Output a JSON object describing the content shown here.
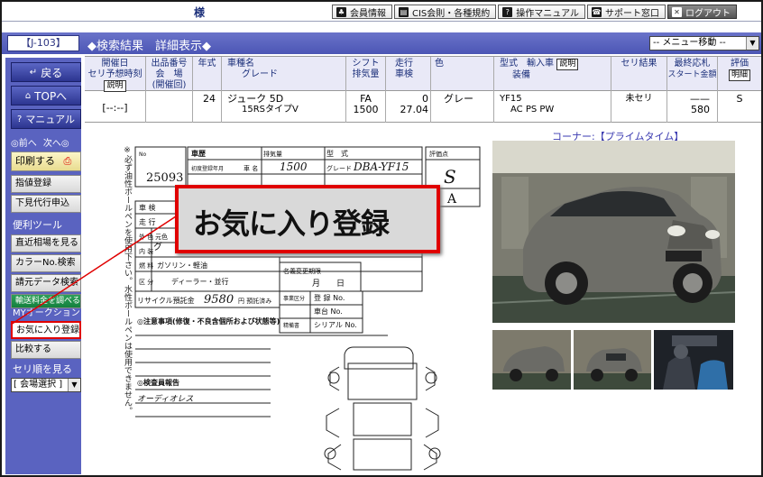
{
  "header": {
    "user_suffix": "様",
    "links": [
      {
        "icon": "club-icon",
        "glyph": "♣",
        "label": "会員情報"
      },
      {
        "icon": "cis-icon",
        "glyph": "▤",
        "label": "CIS会則・各種規約"
      },
      {
        "icon": "help-icon",
        "glyph": "?",
        "label": "操作マニュアル"
      },
      {
        "icon": "phone-icon",
        "glyph": "☎",
        "label": "サポート窓口"
      },
      {
        "icon": "close-icon",
        "glyph": "✕",
        "label": "ログアウト"
      }
    ]
  },
  "titlebar": {
    "id": "【J-103】",
    "title": "◆検索結果　詳細表示◆",
    "menu": "-- メニュー移動 --"
  },
  "sidebar": {
    "back": "戻る",
    "top": "TOPへ",
    "manual": "マニュアル",
    "prev": "◎前へ",
    "next": "次へ◎",
    "print": "印刷する",
    "bid": "指値登録",
    "order": "下見代行申込",
    "tools_heading": "便利ツール",
    "market": "直近相場を見る",
    "color_search": "カラーNo.検索",
    "past_data": "請元データ検索",
    "fee": "輸送料金を調べる",
    "my_auction": "MYオークション",
    "favorite": "お気に入り登録",
    "compare": "比較する",
    "order_heading": "セリ順を見る",
    "venue_select": "[ 会場選択 ]"
  },
  "table": {
    "headers": {
      "date": [
        "開催日",
        "セリ予想時刻"
      ],
      "date_btn": "説明",
      "lot": [
        "出品番号",
        "会　場",
        "(開催回)"
      ],
      "year": "年式",
      "model": [
        "車種名",
        "グレード"
      ],
      "shift": [
        "シフト",
        "排気量"
      ],
      "mileage": [
        "走行",
        "車検"
      ],
      "color": "色",
      "type": [
        "型式　輸入車",
        "装備"
      ],
      "type_btn": "説明",
      "result": "セリ結果",
      "price": [
        "最終応札",
        "スタート金額"
      ],
      "grade": "評価",
      "grade_btn": "明細"
    },
    "row": {
      "date": "[--:--]",
      "lot": "",
      "year": "24",
      "model": "ジューク 5D",
      "grade_name": "15RSタイプV",
      "shift": "FA",
      "cc": "1500",
      "mileage": "0",
      "inspection": "27.04",
      "color": "グレー",
      "type": "YF15",
      "equipment": "AC PS PW",
      "result": "未セリ",
      "final_bid": "——",
      "start_price": "580",
      "score": "S"
    }
  },
  "corner_label": "コーナー:【プライムタイム】",
  "sheet": {
    "lot_no": "25093",
    "mileage_hand": "1500",
    "type_hand": "DBA-YF15",
    "grade_hand": "S",
    "score_a": "A",
    "fuel": "ガソリン・軽油",
    "dealer": "ディーラー・並行",
    "recycle_label": "リサイクル預託金",
    "recycle_value": "9580",
    "recycle_unit": "円 預託済み",
    "remarks_label": "◎注意事項(修復・不良含個所および状態等)",
    "inspector_label": "◎検査員報告",
    "inspector_note": "オーディオレス",
    "vertical_note": "※必ず油性ボールペンを使用下さい。水性ボールペンは使用できません。"
  },
  "zoom_label": "お気に入り登録",
  "colors": {
    "brand": "#5a63c0",
    "highlight": "#e00000"
  }
}
